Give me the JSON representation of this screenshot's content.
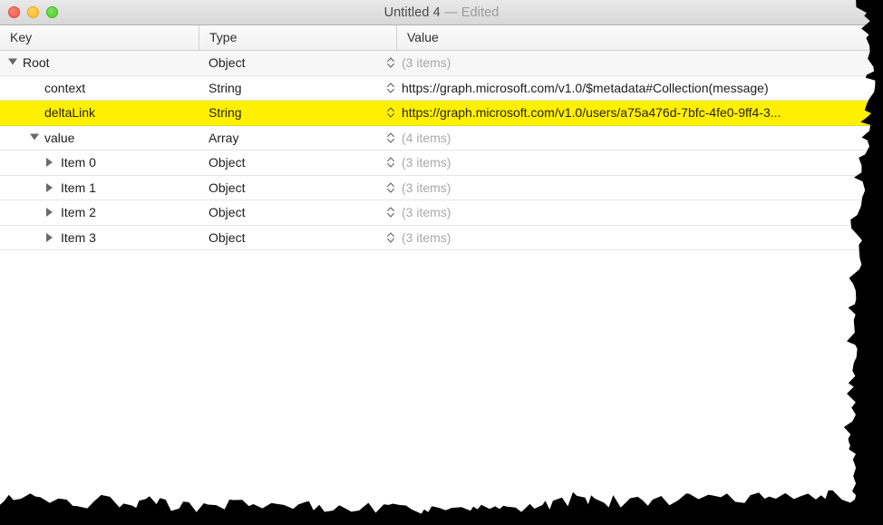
{
  "window": {
    "title_document": "Untitled 4",
    "title_separator": "—",
    "title_state": "Edited",
    "traffic_lights": {
      "close_label": "close",
      "minimize_label": "minimize",
      "maximize_label": "maximize"
    }
  },
  "colors": {
    "selection_highlight": "#fff000",
    "titlebar_top": "#e9e9e9",
    "titlebar_bottom": "#d8d8d8",
    "header_background": "#f5f5f5",
    "row_separator": "#e6e6e6",
    "muted_text": "#a8a8a8",
    "tear_black": "#000000"
  },
  "columns": [
    {
      "id": "key",
      "label": "Key"
    },
    {
      "id": "type",
      "label": "Type"
    },
    {
      "id": "value",
      "label": "Value"
    }
  ],
  "rows": [
    {
      "key": "Root",
      "type": "Object",
      "value": "(3 items)",
      "value_muted": true,
      "level": 0,
      "disclosure": "open",
      "disclosure_icon": "triangle-down-icon",
      "selected": false,
      "shaded": true,
      "stepper_icon": "stepper-up-down-icon"
    },
    {
      "key": "context",
      "type": "String",
      "value": "https://graph.microsoft.com/v1.0/$metadata#Collection(message)",
      "value_muted": false,
      "level": 1,
      "disclosure": "none",
      "disclosure_icon": "",
      "selected": false,
      "shaded": false,
      "stepper_icon": "stepper-up-down-icon"
    },
    {
      "key": "deltaLink",
      "type": "String",
      "value": "https://graph.microsoft.com/v1.0/users/a75a476d-7bfc-4fe0-9ff4-3...",
      "value_muted": false,
      "level": 1,
      "disclosure": "none",
      "disclosure_icon": "",
      "selected": true,
      "shaded": false,
      "stepper_icon": "stepper-up-down-icon"
    },
    {
      "key": "value",
      "type": "Array",
      "value": "(4 items)",
      "value_muted": true,
      "level": 1,
      "disclosure": "open",
      "disclosure_icon": "triangle-down-icon",
      "selected": false,
      "shaded": false,
      "stepper_icon": "stepper-up-down-icon"
    },
    {
      "key": "Item 0",
      "type": "Object",
      "value": "(3 items)",
      "value_muted": true,
      "level": 2,
      "disclosure": "closed",
      "disclosure_icon": "triangle-right-icon",
      "selected": false,
      "shaded": false,
      "stepper_icon": "stepper-up-down-icon"
    },
    {
      "key": "Item 1",
      "type": "Object",
      "value": "(3 items)",
      "value_muted": true,
      "level": 2,
      "disclosure": "closed",
      "disclosure_icon": "triangle-right-icon",
      "selected": false,
      "shaded": false,
      "stepper_icon": "stepper-up-down-icon"
    },
    {
      "key": "Item 2",
      "type": "Object",
      "value": "(3 items)",
      "value_muted": true,
      "level": 2,
      "disclosure": "closed",
      "disclosure_icon": "triangle-right-icon",
      "selected": false,
      "shaded": false,
      "stepper_icon": "stepper-up-down-icon"
    },
    {
      "key": "Item 3",
      "type": "Object",
      "value": "(3 items)",
      "value_muted": true,
      "level": 2,
      "disclosure": "closed",
      "disclosure_icon": "triangle-right-icon",
      "selected": false,
      "shaded": false,
      "stepper_icon": "stepper-up-down-icon"
    }
  ]
}
